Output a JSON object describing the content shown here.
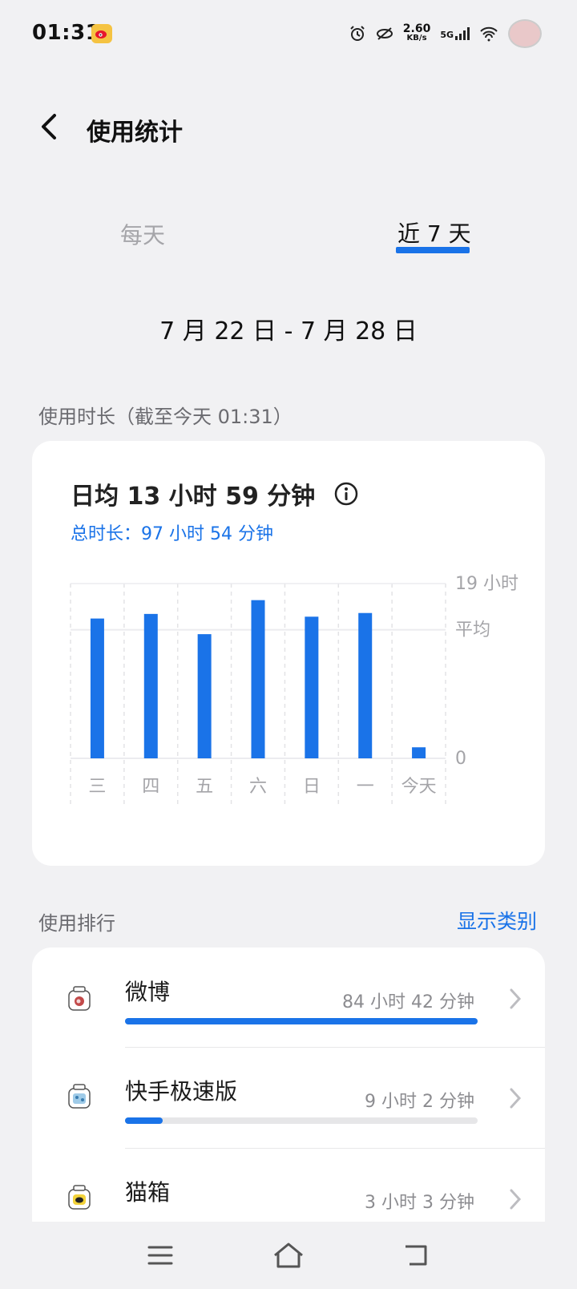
{
  "status": {
    "time": "01:31",
    "speed_value": "2.60",
    "speed_unit": "KB/s",
    "network": "5G"
  },
  "header": {
    "title": "使用统计"
  },
  "tabs": [
    {
      "label": "每天",
      "selected": false
    },
    {
      "label": "近 7 天",
      "selected": true
    }
  ],
  "date_range": "7 月 22 日 - 7 月 28 日",
  "usage": {
    "section_title": "使用时长（截至今天 01:31）",
    "daily_average": "日均 13 小时 59 分钟",
    "total": "总时长：97 小时 54 分钟"
  },
  "chart_data": {
    "type": "bar",
    "categories": [
      "三",
      "四",
      "五",
      "六",
      "日",
      "一",
      "今天"
    ],
    "values": [
      15.2,
      15.7,
      13.5,
      17.2,
      15.4,
      15.8,
      1.2
    ],
    "y_ticks": [
      "19 小时",
      "平均",
      "0"
    ],
    "ylim": [
      0,
      19
    ],
    "average": 13.98,
    "color": "#1a73e8",
    "grid": true
  },
  "ranking": {
    "section_title": "使用排行",
    "show_category": "显示类别",
    "items": [
      {
        "name": "微博",
        "time": "84 小时 42 分钟",
        "fraction": 1.0
      },
      {
        "name": "快手极速版",
        "time": "9 小时 2 分钟",
        "fraction": 0.107
      },
      {
        "name": "猫箱",
        "time": "3 小时 3 分钟",
        "fraction": 0.036
      }
    ]
  }
}
